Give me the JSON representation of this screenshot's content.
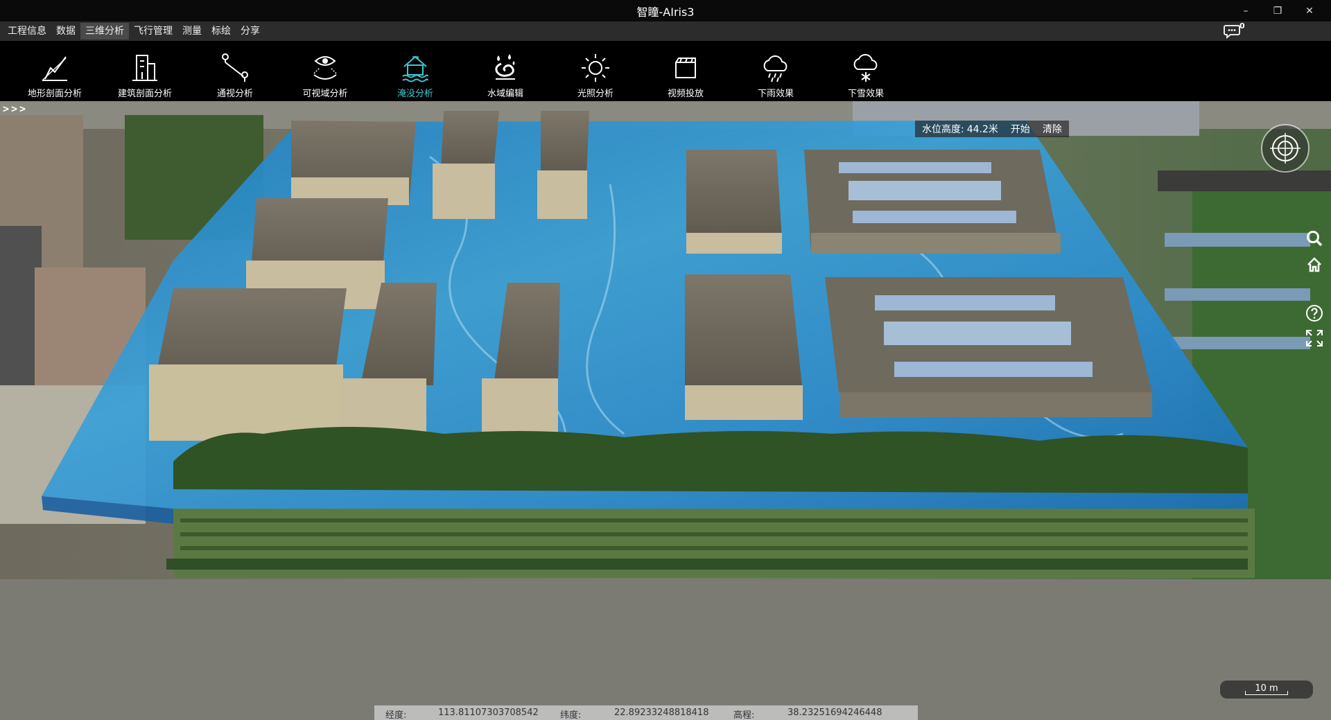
{
  "window": {
    "title": "智瞳-AIris3",
    "minimize": "–",
    "maximize": "❐",
    "close": "✕"
  },
  "menu": {
    "items": [
      {
        "label": "工程信息"
      },
      {
        "label": "数据"
      },
      {
        "label": "三维分析",
        "active": true
      },
      {
        "label": "飞行管理"
      },
      {
        "label": "测量"
      },
      {
        "label": "标绘"
      },
      {
        "label": "分享"
      }
    ],
    "message_badge": "0"
  },
  "toolbar": {
    "items": [
      {
        "label": "地形剖面分析",
        "icon": "terrain-profile-icon"
      },
      {
        "label": "建筑剖面分析",
        "icon": "building-profile-icon"
      },
      {
        "label": "通视分析",
        "icon": "line-of-sight-icon"
      },
      {
        "label": "可视域分析",
        "icon": "viewshed-icon"
      },
      {
        "label": "淹没分析",
        "icon": "flood-icon",
        "active": true
      },
      {
        "label": "水域编辑",
        "icon": "water-edit-icon"
      },
      {
        "label": "光照分析",
        "icon": "sunlight-icon"
      },
      {
        "label": "视频投放",
        "icon": "video-icon"
      },
      {
        "label": "下雨效果",
        "icon": "rain-icon"
      },
      {
        "label": "下雪效果",
        "icon": "snow-icon"
      }
    ],
    "active_color": "#3ec9d6"
  },
  "viewport": {
    "expand_toggle": ">>>",
    "water_panel": {
      "label": "水位高度:",
      "value": "44.2米",
      "start": "开始",
      "clear": "清除"
    },
    "side_tools": [
      "search-icon",
      "home-icon",
      "help-icon",
      "fullscreen-icon"
    ],
    "scale": "10 m"
  },
  "status": {
    "lon_label": "经度:",
    "lon_value": "113.81107303708542",
    "lat_label": "纬度:",
    "lat_value": "22.89233248818418",
    "alt_label": "高程:",
    "alt_value": "38.23251694246448"
  }
}
